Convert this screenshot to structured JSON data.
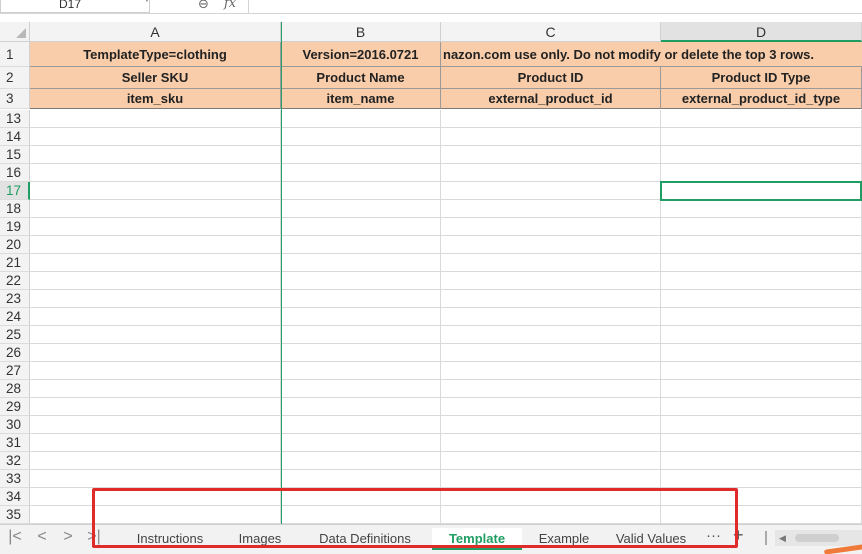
{
  "formula_bar": {
    "name_box": "D17",
    "fx_label": "fx",
    "formula": ""
  },
  "columns": [
    {
      "letter": "A",
      "selected": false
    },
    {
      "letter": "B",
      "selected": false
    },
    {
      "letter": "C",
      "selected": false
    },
    {
      "letter": "D",
      "selected": true
    }
  ],
  "header_rows": [
    {
      "num": "1",
      "cells": [
        "TemplateType=clothing",
        "Version=2016.0721",
        "nazon.com use only. Do not modify or delete the top 3 rows.",
        ""
      ]
    },
    {
      "num": "2",
      "cells": [
        "Seller SKU",
        "Product Name",
        "Product ID",
        "Product ID Type"
      ]
    },
    {
      "num": "3",
      "cells": [
        "item_sku",
        "item_name",
        "external_product_id",
        "external_product_id_type"
      ]
    }
  ],
  "body_rows": [
    "13",
    "14",
    "15",
    "16",
    "17",
    "18",
    "19",
    "20",
    "21",
    "22",
    "23",
    "24",
    "25",
    "26",
    "27",
    "28",
    "29",
    "30",
    "31",
    "32",
    "33",
    "34",
    "35"
  ],
  "selected_row": "17",
  "sheet_tabs": [
    {
      "label": "Instructions",
      "active": false
    },
    {
      "label": "Images",
      "active": false
    },
    {
      "label": "Data Definitions",
      "active": false
    },
    {
      "label": "Template",
      "active": true
    },
    {
      "label": "Example",
      "active": false
    },
    {
      "label": "Valid Values",
      "active": false
    }
  ],
  "tab_nav": {
    "first": "|<",
    "prev": "<",
    "next": ">",
    "last": ">|",
    "more": "···",
    "add": "+"
  },
  "icons": {
    "zoom": "zoom-icon",
    "fx": "fx-icon",
    "dropdown": "chevron-down-icon"
  },
  "colors": {
    "header_fill": "#f9cdaa",
    "accent": "#1f9d62",
    "annotation": "#e02b2b"
  }
}
